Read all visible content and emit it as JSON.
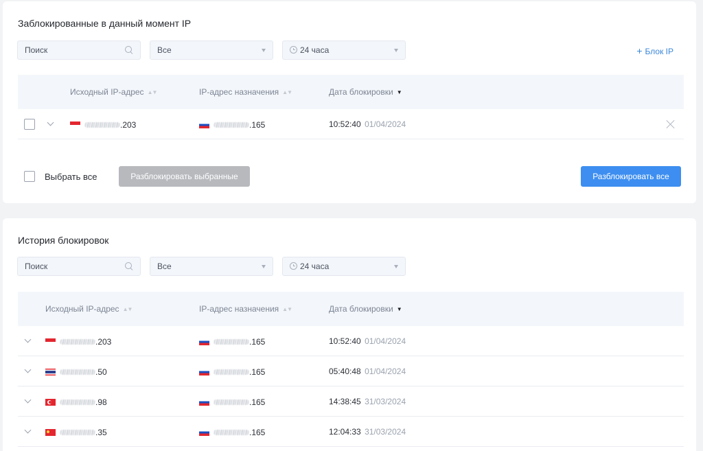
{
  "current": {
    "title": "Заблокированные в данный момент IP",
    "search_placeholder": "Поиск",
    "filter_all": "Все",
    "filter_period": "24 часа",
    "add_block": "Блок IP",
    "columns": {
      "source": "Исходный IP-адрес",
      "dest": "IP-адрес назначения",
      "date": "Дата блокировки"
    },
    "rows": [
      {
        "source_suffix": ".203",
        "source_flag": "id",
        "dest_suffix": ".165",
        "dest_flag": "ru",
        "time": "10:52:40",
        "date": "01/04/2024"
      }
    ],
    "select_all": "Выбрать все",
    "unblock_selected": "Разблокировать выбранные",
    "unblock_all": "Разблокировать все"
  },
  "history": {
    "title": "История блокировок",
    "search_placeholder": "Поиск",
    "filter_all": "Все",
    "filter_period": "24 часа",
    "columns": {
      "source": "Исходный IP-адрес",
      "dest": "IP-адрес назначения",
      "date": "Дата блокировки"
    },
    "rows": [
      {
        "source_suffix": ".203",
        "source_flag": "id",
        "dest_suffix": ".165",
        "dest_flag": "ru",
        "time": "10:52:40",
        "date": "01/04/2024"
      },
      {
        "source_suffix": ".50",
        "source_flag": "th",
        "dest_suffix": ".165",
        "dest_flag": "ru",
        "time": "05:40:48",
        "date": "01/04/2024"
      },
      {
        "source_suffix": ".98",
        "source_flag": "tr",
        "dest_suffix": ".165",
        "dest_flag": "ru",
        "time": "14:38:45",
        "date": "31/03/2024"
      },
      {
        "source_suffix": ".35",
        "source_flag": "cn",
        "dest_suffix": ".165",
        "dest_flag": "ru",
        "time": "12:04:33",
        "date": "31/03/2024"
      }
    ]
  }
}
